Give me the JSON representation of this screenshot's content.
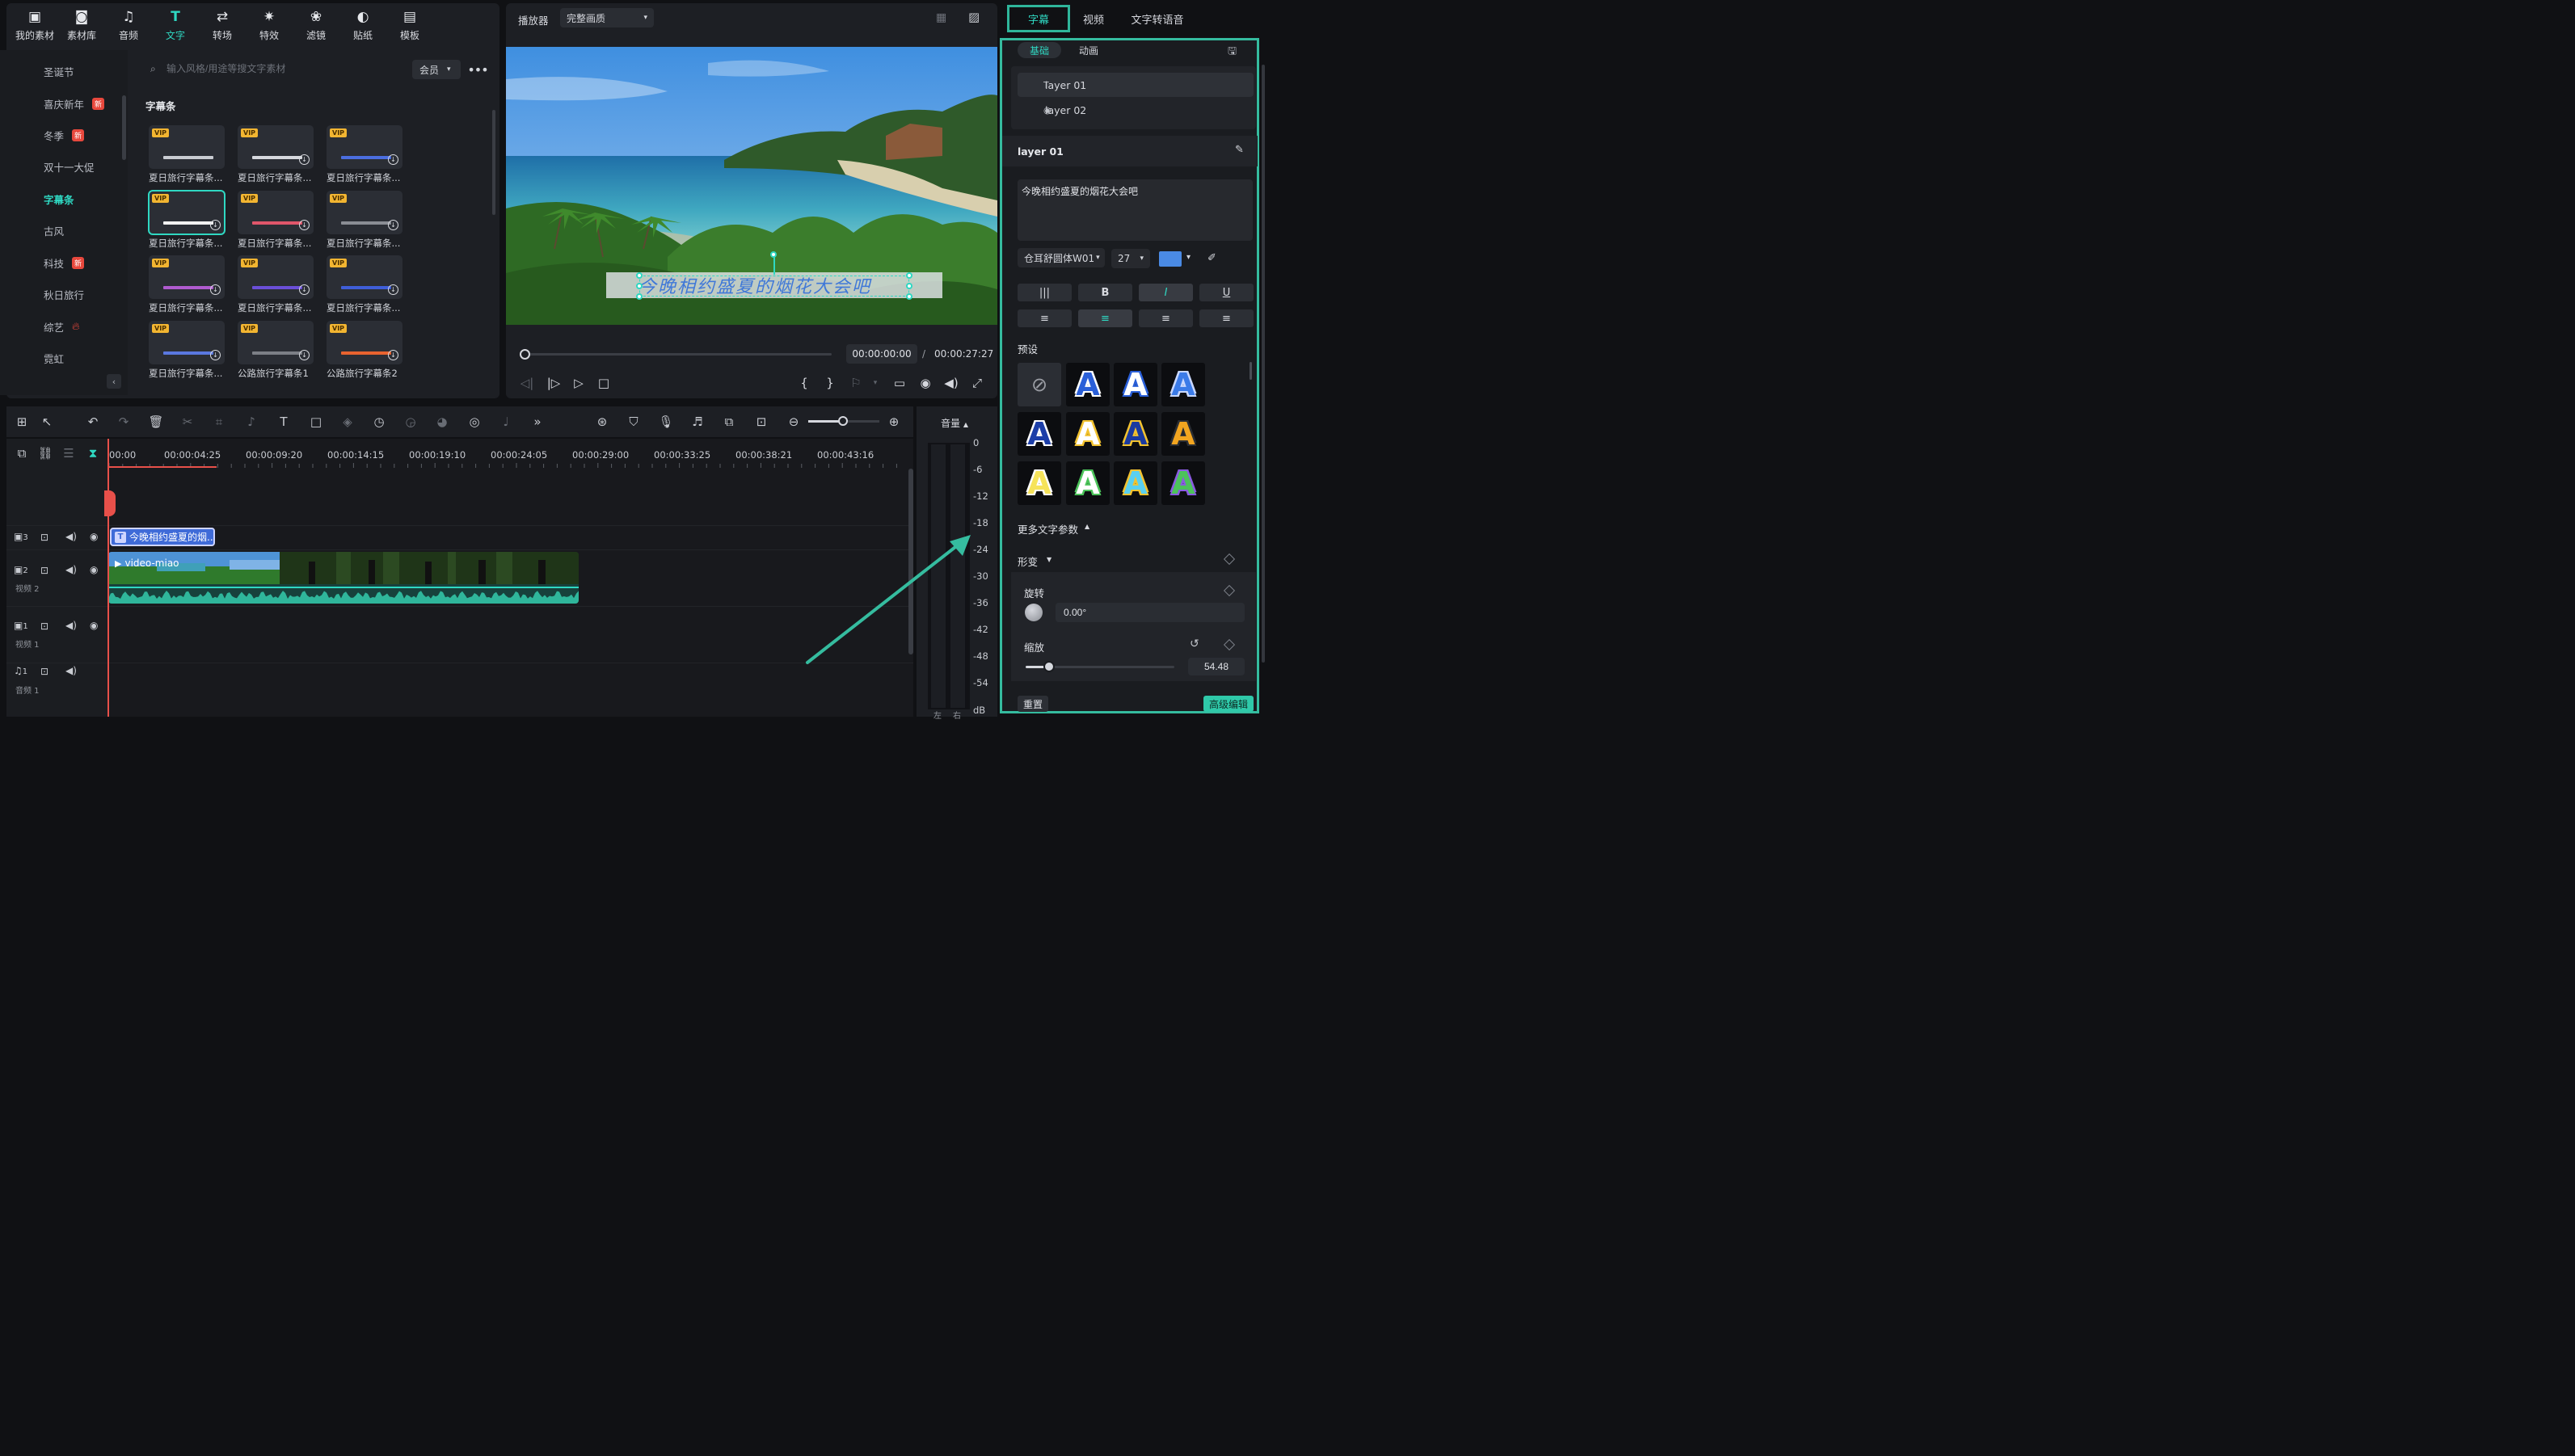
{
  "library": {
    "tabs": [
      {
        "label": "我的素材",
        "icon": "media-icon"
      },
      {
        "label": "素材库",
        "icon": "stock-icon"
      },
      {
        "label": "音频",
        "icon": "music-note-icon"
      },
      {
        "label": "文字",
        "icon": "text-icon"
      },
      {
        "label": "转场",
        "icon": "transition-icon"
      },
      {
        "label": "特效",
        "icon": "effects-icon"
      },
      {
        "label": "滤镜",
        "icon": "filter-icon"
      },
      {
        "label": "贴纸",
        "icon": "sticker-icon"
      },
      {
        "label": "模板",
        "icon": "template-icon"
      }
    ],
    "active_tab": "文字",
    "categories": [
      {
        "label": "圣诞节",
        "badge": ""
      },
      {
        "label": "喜庆新年",
        "badge": "新"
      },
      {
        "label": "冬季",
        "badge": "新"
      },
      {
        "label": "双十一大促",
        "badge": ""
      },
      {
        "label": "字幕条",
        "badge": ""
      },
      {
        "label": "古风",
        "badge": ""
      },
      {
        "label": "科技",
        "badge": "新"
      },
      {
        "label": "秋日旅行",
        "badge": ""
      },
      {
        "label": "综艺",
        "badge": "fire"
      },
      {
        "label": "霓虹",
        "badge": ""
      }
    ],
    "active_category": "字幕条",
    "search": {
      "placeholder": "输入风格/用途等搜文字素材"
    },
    "filter_select": "会员",
    "more_label": "•••",
    "collapse_label": "‹",
    "section_title": "字幕条",
    "vip_label": "VIP",
    "download_label": "↓",
    "assets": [
      {
        "label": "夏日旅行字幕条...",
        "bar_color": "#c9ccd2"
      },
      {
        "label": "夏日旅行字幕条...",
        "bar_color": "#d6d8de"
      },
      {
        "label": "夏日旅行字幕条...",
        "bar_color": "#4b6ee0"
      },
      {
        "label": "夏日旅行字幕条...",
        "bar_color": "#f1f1f1"
      },
      {
        "label": "夏日旅行字幕条...",
        "bar_color": "#e0566a"
      },
      {
        "label": "夏日旅行字幕条...",
        "bar_color": "#8a8d94"
      },
      {
        "label": "夏日旅行字幕条...",
        "bar_color": "#b05bd0"
      },
      {
        "label": "夏日旅行字幕条...",
        "bar_color": "#6b4fd8"
      },
      {
        "label": "夏日旅行字幕条...",
        "bar_color": "#3f5ed8"
      },
      {
        "label": "夏日旅行字幕条...",
        "bar_color": "#5a78e0"
      },
      {
        "label": "公路旅行字幕条1",
        "bar_color": "#7c7f86"
      },
      {
        "label": "公路旅行字幕条2",
        "bar_color": "#e8632f"
      }
    ]
  },
  "player": {
    "label": "播放器",
    "quality": "完整画质",
    "caption": "今晚相约盛夏的烟花大会吧",
    "time_current": "00:00:00:00",
    "time_separator": "/",
    "time_total": "00:00:27:27",
    "progress": 0
  },
  "right_panel": {
    "tabs": [
      "字幕",
      "视频",
      "文字转语音"
    ],
    "active_tab": "字幕",
    "subtabs": [
      "基础",
      "动画"
    ],
    "layers": [
      "layer 01",
      "layer 02"
    ],
    "layer_title": "layer 01",
    "text_value": "今晚相约盛夏的烟花大会吧",
    "font": "仓耳舒圆体W01",
    "font_size": "27",
    "text_color": "#4a8ae4",
    "format_buttons": [
      "|||",
      "B",
      "I",
      "U"
    ],
    "align_buttons": [
      "≡",
      "≡",
      "≡",
      "≡"
    ],
    "preset_title": "预设",
    "preset_letter": "A",
    "presets": [
      {
        "fill": "#2a5fd8",
        "stroke": "#ffffff"
      },
      {
        "fill": "#ffffff",
        "stroke": "#2a5fd8"
      },
      {
        "fill": "#3b7be8",
        "stroke": "#c9d8ff"
      },
      {
        "fill": "#1c3ea8",
        "stroke": "#ffffff"
      },
      {
        "fill": "#ffffff",
        "stroke": "#f2c230"
      },
      {
        "fill": "#1a3aa0",
        "stroke": "#f2c230"
      },
      {
        "fill": "#f2a520",
        "stroke": "#2a2d33"
      },
      {
        "fill": "#f6e35a",
        "stroke": "#ffffff"
      },
      {
        "fill": "#ffffff",
        "stroke": "#4cc35a"
      },
      {
        "fill": "#5ad0f0",
        "stroke": "#f2c230"
      },
      {
        "fill": "#4cc35a",
        "stroke": "#8a5be0"
      }
    ],
    "more_params": "更多文字参数",
    "transform_label": "形变",
    "rotate_label": "旋转",
    "rotate_value": "0.00°",
    "scale_label": "缩放",
    "scale_value": "54.48",
    "reset_label": "重置",
    "advanced_label": "高级编辑"
  },
  "timeline": {
    "ruler": [
      "00:00",
      "00:00:04:25",
      "00:00:09:20",
      "00:00:14:15",
      "00:00:19:10",
      "00:00:24:05",
      "00:00:29:00",
      "00:00:33:25",
      "00:00:38:21",
      "00:00:43:16"
    ],
    "tracks": [
      {
        "num": "3",
        "label": ""
      },
      {
        "num": "2",
        "label": "视频 2"
      },
      {
        "num": "1",
        "label": "视频 1"
      },
      {
        "num": "1",
        "label": "音频 1"
      }
    ],
    "title_clip": "今晚相约盛夏的烟...",
    "title_clip_icon": "T",
    "video_clip": "video-miao"
  },
  "meter": {
    "title": "音量",
    "scale": [
      "0",
      "-6",
      "-12",
      "-18",
      "-24",
      "-30",
      "-36",
      "-42",
      "-48",
      "-54",
      "dB"
    ],
    "channels": [
      "左",
      "右"
    ]
  },
  "colors": {
    "accent": "#2fd8c2",
    "playhead": "#e8504a",
    "annotation": "#35bc9f"
  }
}
